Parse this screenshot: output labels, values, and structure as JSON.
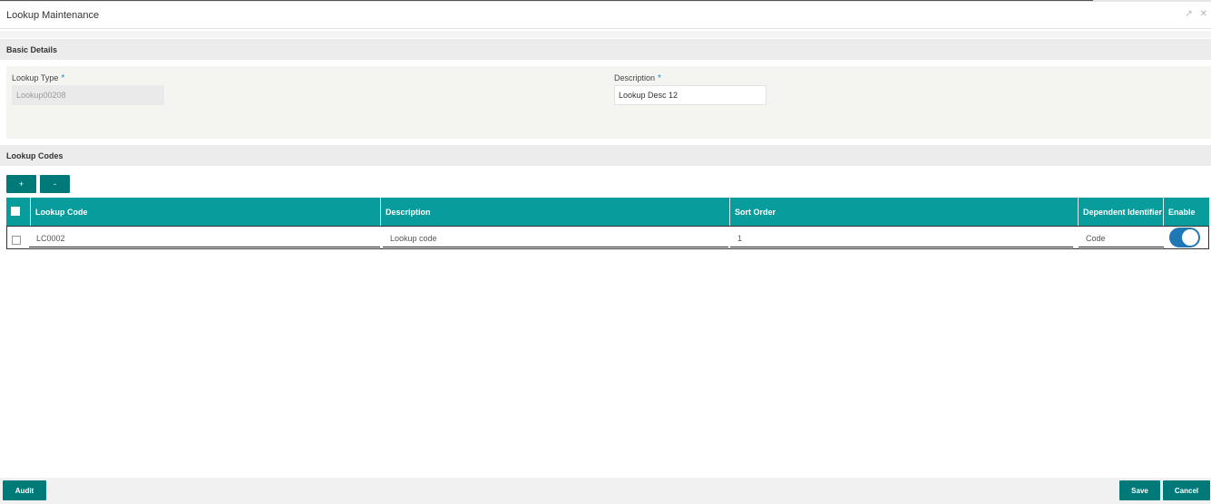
{
  "window": {
    "title": "Lookup Maintenance",
    "minimize_icon": "collapse-icon",
    "close_icon": "close-icon"
  },
  "basic_details": {
    "heading": "Basic Details",
    "lookup_type": {
      "label": "Lookup Type",
      "required_mark": "*",
      "value": "Lookup00208"
    },
    "description": {
      "label": "Description",
      "required_mark": "*",
      "value": "Lookup Desc 12"
    }
  },
  "lookup_codes": {
    "heading": "Lookup Codes",
    "add_label": "+",
    "remove_label": "-",
    "columns": [
      "Lookup Code",
      "Description",
      "Sort Order",
      "Dependent Identifier",
      "Enable"
    ],
    "rows": [
      {
        "lookup_code": "LC0002",
        "description": "Lookup code",
        "sort_order": "1",
        "dependent_identifier": "Code",
        "enabled": true
      }
    ]
  },
  "footer": {
    "audit_label": "Audit",
    "save_label": "Save",
    "cancel_label": "Cancel"
  },
  "colors": {
    "accent": "#007a78",
    "grid_header": "#099c9c",
    "toggle_on": "#1f78b4"
  }
}
